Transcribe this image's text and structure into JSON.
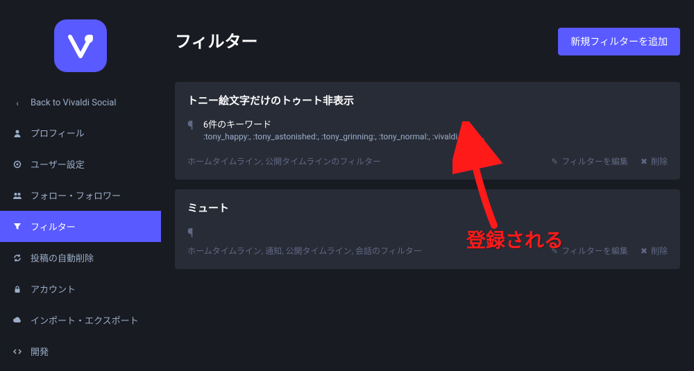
{
  "sidebar": {
    "back_label": "Back to Vivaldi Social",
    "items": [
      {
        "icon": "user",
        "label": "プロフィール"
      },
      {
        "icon": "gear",
        "label": "ユーザー設定"
      },
      {
        "icon": "people",
        "label": "フォロー・フォロワー"
      },
      {
        "icon": "filter",
        "label": "フィルター"
      },
      {
        "icon": "refresh",
        "label": "投稿の自動削除"
      },
      {
        "icon": "lock",
        "label": "アカウント"
      },
      {
        "icon": "cloud",
        "label": "インポート・エクスポート"
      },
      {
        "icon": "code",
        "label": "開発"
      }
    ]
  },
  "page": {
    "title": "フィルター",
    "new_button": "新規フィルターを追加"
  },
  "filters": [
    {
      "title": "トニー絵文字だけのトゥート非表示",
      "kw_count": "6件のキーワード",
      "kw_list": ":tony_happy:, :tony_astonished:, :tony_grinning:, :tony_normal:, :vivaldi_red:, …",
      "contexts": "ホームタイムライン, 公開タイムラインのフィルター",
      "edit": "フィルターを編集",
      "delete": "削除"
    },
    {
      "title": "ミュート",
      "kw_count": "",
      "kw_list": "",
      "contexts": "ホームタイムライン, 通知, 公開タイムライン, 会話のフィルター",
      "edit": "フィルターを編集",
      "delete": "削除"
    }
  ],
  "annotation": {
    "text": "登録される"
  }
}
